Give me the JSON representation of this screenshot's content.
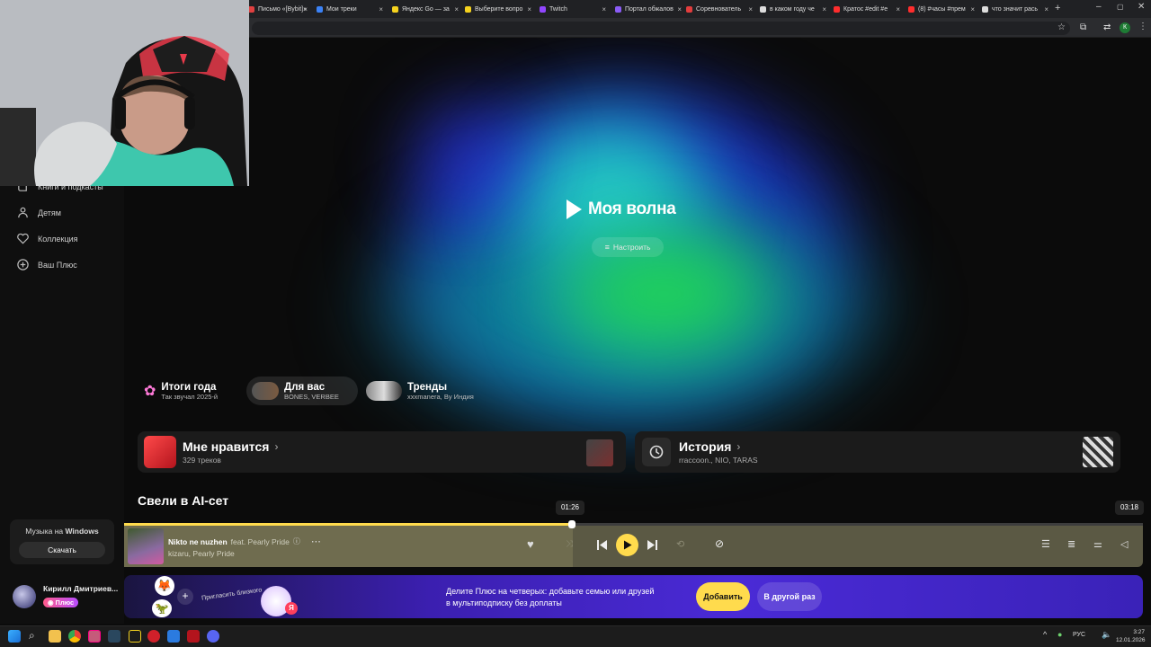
{
  "browser": {
    "tabs": [
      {
        "title": "Письмо «[Bybit]»",
        "color": "#e04040"
      },
      {
        "title": "Мои треки",
        "color": "#3b82f6"
      },
      {
        "title": "Яндекс Go — за",
        "color": "#f5d21e"
      },
      {
        "title": "Выберите вопро",
        "color": "#f5d21e"
      },
      {
        "title": "Twitch",
        "color": "#9146ff"
      },
      {
        "title": "Портал обжалов",
        "color": "#8b5cf6"
      },
      {
        "title": "Соревнователь",
        "color": "#e23d3d"
      },
      {
        "title": "в каком году че",
        "color": "#dddddd"
      },
      {
        "title": "Кратос #edit #e",
        "color": "#ff2d2d"
      },
      {
        "title": "(8) #часы #прем",
        "color": "#ff2d2d"
      },
      {
        "title": "что значит рась",
        "color": "#dddddd"
      }
    ],
    "profile_initial": "К"
  },
  "sidebar": {
    "items": [
      {
        "label": "Книги и подкасты",
        "icon": "book-icon"
      },
      {
        "label": "Детям",
        "icon": "child-icon"
      },
      {
        "label": "Коллекция",
        "icon": "heart-icon"
      },
      {
        "label": "Ваш Плюс",
        "icon": "plus-circle-icon"
      }
    ],
    "promo": {
      "title_prefix": "Музыка на ",
      "title_strong": "Windows",
      "button": "Скачать"
    },
    "user": {
      "name": "Кирилл Дмитриев...",
      "badge": "Плюс"
    }
  },
  "hero": {
    "title": "Моя волна",
    "settings_label": "Настроить"
  },
  "chips": [
    {
      "title": "Итоги года",
      "subtitle": "Так звучал 2025-й"
    },
    {
      "title": "Для вас",
      "subtitle": "BONES, VERBEE"
    },
    {
      "title": "Тренды",
      "subtitle": "xxxmanera, By Индия"
    }
  ],
  "shelves": {
    "liked": {
      "title": "Мне нравится",
      "subtitle": "329 треков"
    },
    "history": {
      "title": "История",
      "subtitle": "rraccoon., NIO, TARAS"
    }
  },
  "section_title": "Свели в AI-сет",
  "player": {
    "track": "Nikto ne nuzhen",
    "feat": "feat. Pearly Pride",
    "artists": "kizaru, Pearly Pride",
    "time_current": "01:26",
    "time_total": "03:18",
    "progress": 0.44,
    "accent": "#ffdb4d"
  },
  "banner": {
    "invite": "Пригласить близкого",
    "text_line1": "Делите Плюс на четверых: добавьте семью или друзей",
    "text_line2": "в мультиподписку без доплаты",
    "add_button": "Добавить",
    "later_button": "В другой раз"
  },
  "taskbar": {
    "lang": "РУС",
    "time": "3:27",
    "date": "12.01.2026"
  }
}
